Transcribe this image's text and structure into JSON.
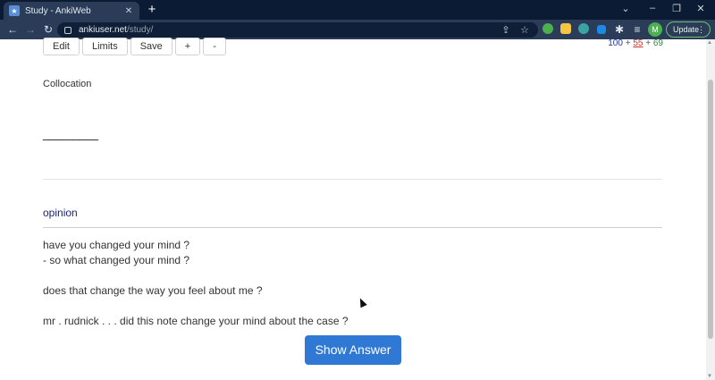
{
  "browser": {
    "tab_title": "Study - AnkiWeb",
    "tab_close": "✕",
    "new_tab": "+",
    "url_host": "ankiuser.net",
    "url_path": "/study/",
    "avatar_letter": "M",
    "update_label": "Update"
  },
  "toolbar": {
    "edit": "Edit",
    "limits": "Limits",
    "save": "Save",
    "plus": "+",
    "minus": "-"
  },
  "counts": {
    "new": "100",
    "learning": "55",
    "review": "69",
    "sep": "+",
    "colors": {
      "new": "#2233aa",
      "learning": "#c0392b",
      "review": "#2e8b2e"
    }
  },
  "card": {
    "type_label": "Collocation",
    "blank": "_________",
    "word": "opinion",
    "examples": [
      "have you changed your mind ?",
      "- so what changed your mind ?",
      "does that change the way you feel about me ?",
      "mr . rudnick . . . did this note change your mind about the case ?"
    ]
  },
  "show_answer": "Show Answer",
  "accent": "#2f79d4"
}
